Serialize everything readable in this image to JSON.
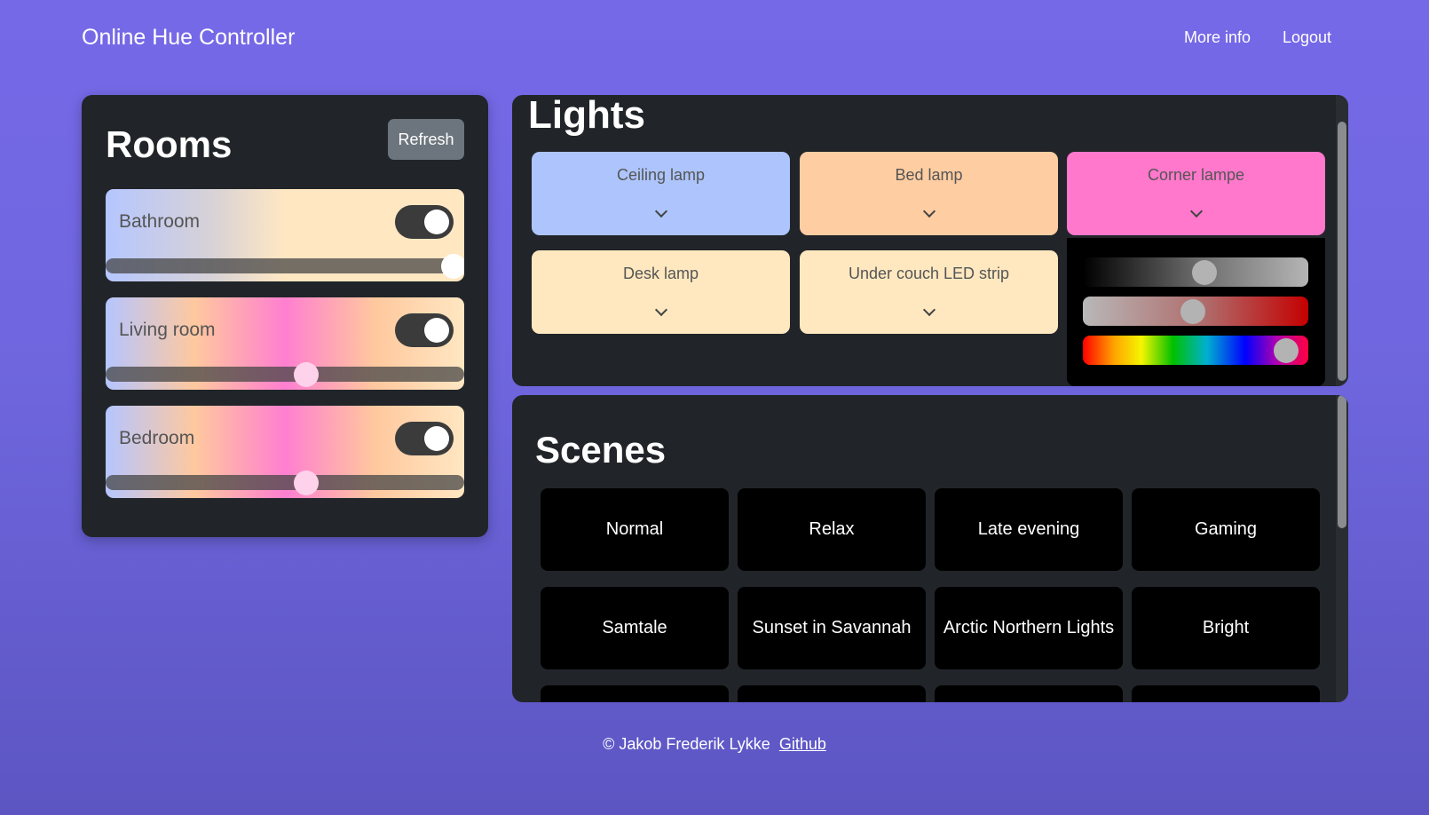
{
  "header": {
    "brand": "Online Hue Controller",
    "nav": {
      "more_info": "More info",
      "logout": "Logout"
    }
  },
  "rooms": {
    "title": "Rooms",
    "refresh_label": "Refresh",
    "items": [
      {
        "name": "Bathroom",
        "on": true,
        "brightness": 0.97
      },
      {
        "name": "Living room",
        "on": true,
        "brightness": 0.56
      },
      {
        "name": "Bedroom",
        "on": true,
        "brightness": 0.56
      }
    ]
  },
  "lights": {
    "title": "Lights",
    "items": [
      {
        "name": "Ceiling lamp",
        "color": "#adc5fc"
      },
      {
        "name": "Bed lamp",
        "color": "#ffcda2"
      },
      {
        "name": "Corner lampe",
        "color": "#ff78cc",
        "expanded": true
      },
      {
        "name": "Desk lamp",
        "color": "#ffe8c0"
      },
      {
        "name": "Under couch LED strip",
        "color": "#ffe8c0"
      }
    ],
    "expanded_controls": {
      "brightness": 0.54,
      "saturation": 0.49,
      "hue": 0.9
    }
  },
  "scenes": {
    "title": "Scenes",
    "items": [
      "Normal",
      "Relax",
      "Late evening",
      "Gaming",
      "Samtale",
      "Sunset in Savannah",
      "Arctic Northern Lights",
      "Bright"
    ]
  },
  "footer": {
    "copyright": "© Jakob Frederik Lykke",
    "link": "Github"
  }
}
